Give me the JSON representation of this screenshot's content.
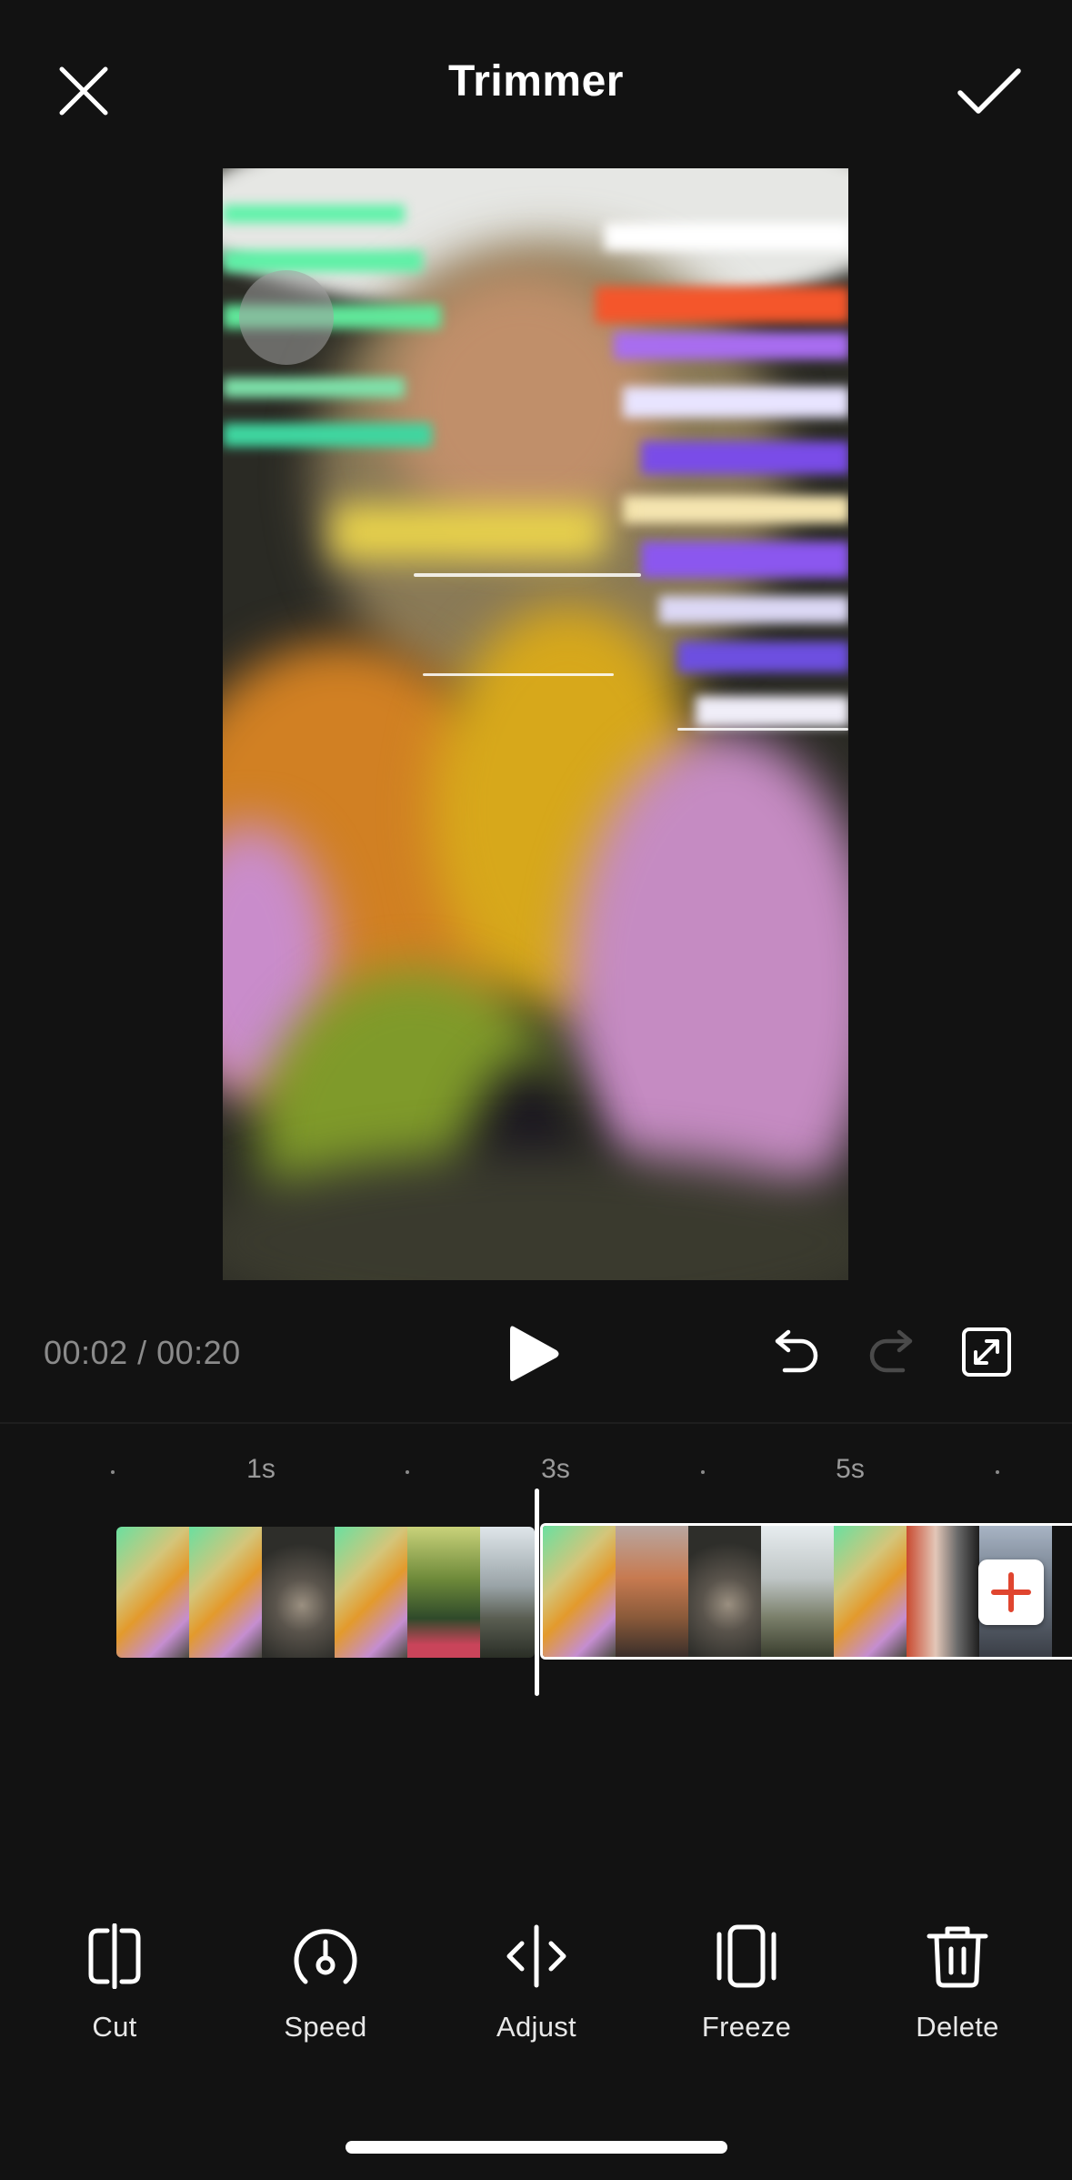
{
  "header": {
    "title": "Trimmer",
    "close_icon": "close-icon",
    "confirm_icon": "checkmark-icon"
  },
  "playback": {
    "current_time": "00:02",
    "separator": " / ",
    "total_time": "00:20",
    "play_icon": "play-icon",
    "undo_icon": "undo-icon",
    "redo_icon": "redo-icon",
    "fullscreen_icon": "fullscreen-icon"
  },
  "ruler": {
    "labels": [
      "1s",
      "3s",
      "5s"
    ]
  },
  "timeline": {
    "add_icon": "plus-icon",
    "accent_color": "#e0452f"
  },
  "toolbar": {
    "items": [
      {
        "label": "Cut",
        "icon": "split-icon"
      },
      {
        "label": "Speed",
        "icon": "speedometer-icon"
      },
      {
        "label": "Adjust",
        "icon": "adjust-icon"
      },
      {
        "label": "Freeze",
        "icon": "freeze-icon"
      },
      {
        "label": "Delete",
        "icon": "trash-icon"
      }
    ]
  }
}
